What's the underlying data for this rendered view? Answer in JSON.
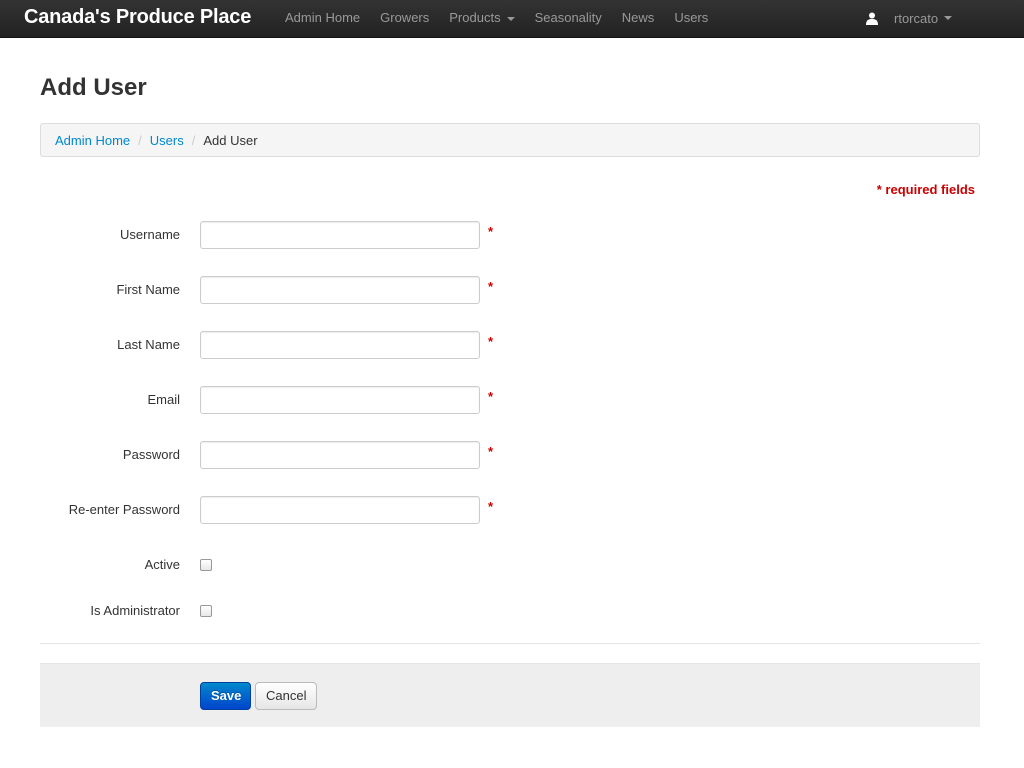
{
  "navbar": {
    "brand": "Canada's Produce Place",
    "items": [
      {
        "label": "Admin Home"
      },
      {
        "label": "Growers"
      },
      {
        "label": "Products"
      },
      {
        "label": "Seasonality"
      },
      {
        "label": "News"
      },
      {
        "label": "Users"
      }
    ],
    "user": "rtorcato"
  },
  "page": {
    "title": "Add User"
  },
  "breadcrumb": {
    "items": [
      "Admin Home",
      "Users",
      "Add User"
    ],
    "separator": "/"
  },
  "form": {
    "required_note": "* required fields",
    "required_marker": "*",
    "fields": [
      {
        "label": "Username",
        "value": ""
      },
      {
        "label": "First Name",
        "value": ""
      },
      {
        "label": "Last Name",
        "value": ""
      },
      {
        "label": "Email",
        "value": ""
      },
      {
        "label": "Password",
        "value": ""
      },
      {
        "label": "Re-enter Password",
        "value": ""
      }
    ],
    "checkboxes": [
      {
        "label": "Active",
        "checked": false
      },
      {
        "label": "Is Administrator",
        "checked": false
      }
    ],
    "save_label": "Save",
    "cancel_label": "Cancel"
  },
  "colors": {
    "link": "#0088cc",
    "required": "#cc0000",
    "primary_button": "#0055cc",
    "navbar": "#222222"
  }
}
